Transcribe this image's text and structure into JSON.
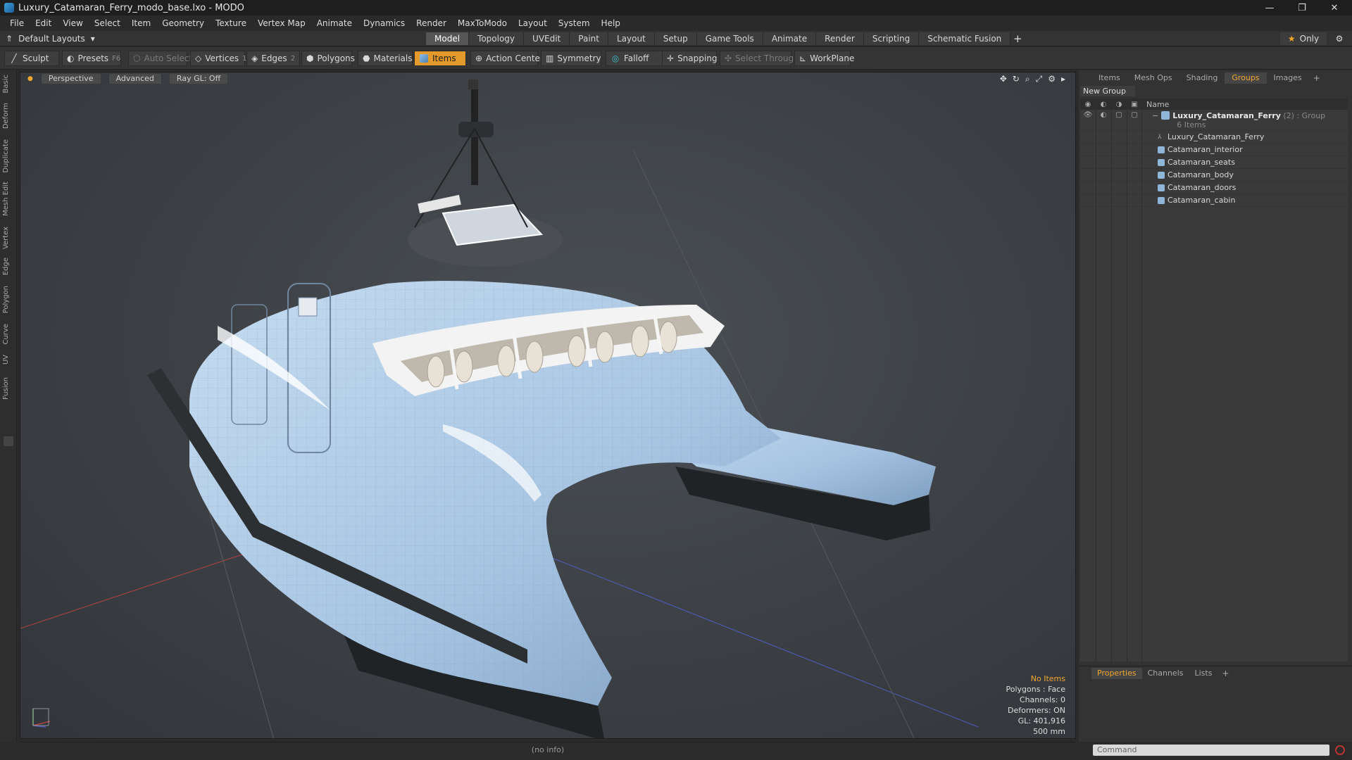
{
  "window": {
    "title": "Luxury_Catamaran_Ferry_modo_base.lxo - MODO",
    "minimize": "—",
    "restore": "❐",
    "close": "✕"
  },
  "menu": [
    "File",
    "Edit",
    "View",
    "Select",
    "Item",
    "Geometry",
    "Texture",
    "Vertex Map",
    "Animate",
    "Dynamics",
    "Render",
    "MaxToModo",
    "Layout",
    "System",
    "Help"
  ],
  "layout": {
    "selector": "Default Layouts",
    "tabs": [
      "Model",
      "Topology",
      "UVEdit",
      "Paint",
      "Layout",
      "Setup",
      "Game Tools",
      "Animate",
      "Render",
      "Scripting",
      "Schematic Fusion"
    ],
    "active_tab": "Model",
    "only_label": "Only"
  },
  "toolbar": {
    "sculpt": "Sculpt",
    "presets": "Presets",
    "presets_key": "F6",
    "auto_select": "Auto Select",
    "vertices": "Vertices",
    "vertices_num": "1",
    "edges": "Edges",
    "edges_num": "2",
    "polygons": "Polygons",
    "materials": "Materials",
    "items": "Items",
    "action_center": "Action Center",
    "symmetry": "Symmetry",
    "falloff": "Falloff",
    "snapping": "Snapping",
    "select_through": "Select Through",
    "workplane": "WorkPlane"
  },
  "left_tabs": [
    "Basic",
    "Deform",
    "Duplicate",
    "Mesh Edit",
    "Vertex",
    "Edge",
    "Polygon",
    "Curve",
    "UV",
    "Fusion"
  ],
  "viewport": {
    "perspective": "Perspective",
    "advanced": "Advanced",
    "raygl": "Ray GL: Off",
    "info": {
      "no_items": "No Items",
      "polygons": "Polygons : Face",
      "channels": "Channels: 0",
      "deformers": "Deformers: ON",
      "gl": "GL: 401,916",
      "scale": "500 mm"
    }
  },
  "status": "(no info)",
  "right_panel": {
    "tabs": [
      "Items",
      "Mesh Ops",
      "Shading",
      "Groups",
      "Images"
    ],
    "active_tab": "Groups",
    "new_group": "New Group",
    "name_col": "Name",
    "group": {
      "name": "Luxury_Catamaran_Ferry",
      "meta": "(2) : Group",
      "count": "6 Items"
    },
    "items": [
      "Luxury_Catamaran_Ferry",
      "Catamaran_interior",
      "Catamaran_seats",
      "Catamaran_body",
      "Catamaran_doors",
      "Catamaran_cabin"
    ]
  },
  "bottom_panel": {
    "tabs": [
      "Properties",
      "Channels",
      "Lists"
    ],
    "active_tab": "Properties"
  },
  "command": {
    "placeholder": "Command"
  },
  "colors": {
    "accent": "#f0a830",
    "hull": "#a8c8e8"
  }
}
